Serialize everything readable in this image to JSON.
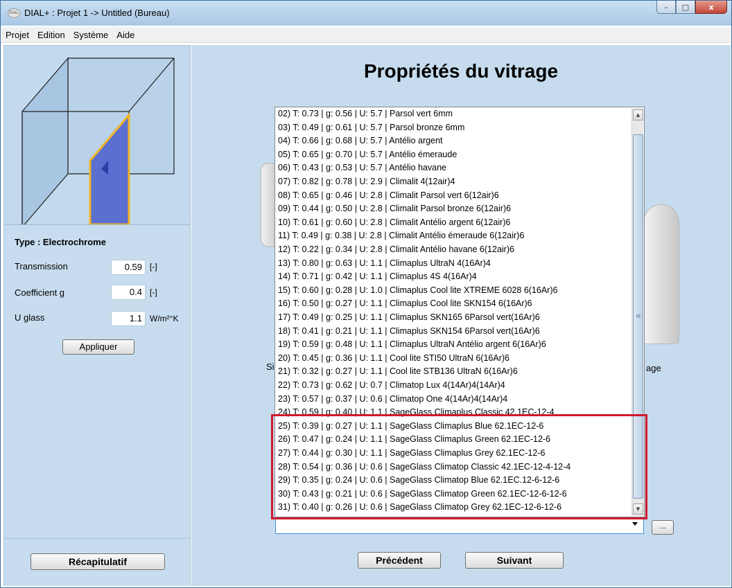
{
  "window": {
    "title": "DIAL+ : Projet 1 -> Untitled (Bureau)",
    "app_icon_text": "DIAL",
    "minimize": "–",
    "maximize": "□",
    "close": "x"
  },
  "menu": [
    "Projet",
    "Edition",
    "Système",
    "Aide"
  ],
  "left": {
    "type_label": "Type : Electrochrome",
    "props": [
      {
        "label": "Transmission",
        "value": "0.59",
        "unit": "[-]"
      },
      {
        "label": "Coefficient g",
        "value": "0.4",
        "unit": "[-]"
      },
      {
        "label": "U glass",
        "value": "1.1",
        "unit": "W/m²°K"
      }
    ],
    "apply_button": "Appliquer",
    "recap_button": "Récapitulatif"
  },
  "main": {
    "heading": "Propriétés du vitrage",
    "bg_text_left": "Si",
    "bg_text_right": "age",
    "list_items": [
      "02) T: 0.73 | g: 0.56 | U: 5.7 | Parsol vert 6mm",
      "03) T: 0.49 | g: 0.61 | U: 5.7 | Parsol bronze 6mm",
      "04) T: 0.66 | g: 0.68 | U: 5.7 | Antélio argent",
      "05) T: 0.65 | g: 0.70 | U: 5.7 | Antélio émeraude",
      "06) T: 0.43 | g: 0.53 | U: 5.7 | Antélio havane",
      "07) T: 0.82 | g: 0.78 | U: 2.9 | Climalit 4(12air)4",
      "08) T: 0.65 | g: 0.46 | U: 2.8 | Climalit Parsol vert 6(12air)6",
      "09) T: 0.44 | g: 0.50 | U: 2.8 | Climalit Parsol bronze 6(12air)6",
      "10) T: 0.61 | g: 0.60 | U: 2.8 | Climalit Antélio argent 6(12air)6",
      "11) T: 0.49 | g: 0.38 | U: 2.8 | Climalit Antélio émeraude 6(12air)6",
      "12) T: 0.22 | g: 0.34 | U: 2.8 | Climalit Antélio havane 6(12air)6",
      "13) T: 0.80 | g: 0.63 | U: 1.1 | Climaplus UltraN 4(16Ar)4",
      "14) T: 0.71 | g: 0.42 | U: 1.1 | Climaplus 4S 4(16Ar)4",
      "15) T: 0.60 | g: 0.28 | U: 1.0 | Climaplus Cool lite XTREME 6028 6(16Ar)6",
      "16) T: 0.50 | g: 0.27 | U: 1.1 | Climaplus Cool lite SKN154 6(16Ar)6",
      "17) T: 0.49 | g: 0.25 | U: 1.1 | Climaplus SKN165 6Parsol vert(16Ar)6",
      "18) T: 0.41 | g: 0.21 | U: 1.1 | Climaplus SKN154 6Parsol vert(16Ar)6",
      "19) T: 0.59 | g: 0.48 | U: 1.1 | Climaplus UltraN Antélio argent 6(16Ar)6",
      "20) T: 0.45 | g: 0.36 | U: 1.1 | Cool lite STI50 UltraN 6(16Ar)6",
      "21) T: 0.32 | g: 0.27 | U: 1.1 | Cool lite STB136 UltraN 6(16Ar)6",
      "22) T: 0.73 | g: 0.62 | U: 0.7 | Climatop Lux 4(14Ar)4(14Ar)4",
      "23) T: 0.57 | g: 0.37 | U: 0.6 | Climatop One 4(14Ar)4(14Ar)4",
      "24) T: 0.59 | g: 0.40 | U: 1.1 | SageGlass Climaplus Classic 42.1EC-12-4",
      "25) T: 0.39 | g: 0.27 | U: 1.1 | SageGlass Climaplus Blue 62.1EC-12-6",
      "26) T: 0.47 | g: 0.24 | U: 1.1 | SageGlass Climaplus Green 62.1EC-12-6",
      "27) T: 0.44 | g: 0.30 | U: 1.1 | SageGlass Climaplus Grey 62.1EC-12-6",
      "28) T: 0.54 | g: 0.36 | U: 0.6 | SageGlass Climatop Classic 42.1EC-12-4-12-4",
      "29) T: 0.35 | g: 0.24 | U: 0.6 | SageGlass Climatop Blue 62.1EC.12-6-12-6",
      "30) T: 0.43 | g: 0.21 | U: 0.6 | SageGlass Climatop Green 62.1EC-12-6-12-6",
      "31) T: 0.40 | g: 0.26 | U: 0.6 | SageGlass Climatop Grey 62.1EC-12-6-12-6"
    ],
    "combo_value": "",
    "dots_button": "...",
    "prev_button": "Précédent",
    "next_button": "Suivant"
  },
  "icons": {
    "scroll_up": "▲",
    "scroll_down": "▼",
    "thumb_grip": "≡"
  },
  "colors": {
    "highlight": "#d0192a",
    "panel": "#c6dcee",
    "cube_face": "#5a6fd0",
    "cube_edge": "#f0b428"
  }
}
